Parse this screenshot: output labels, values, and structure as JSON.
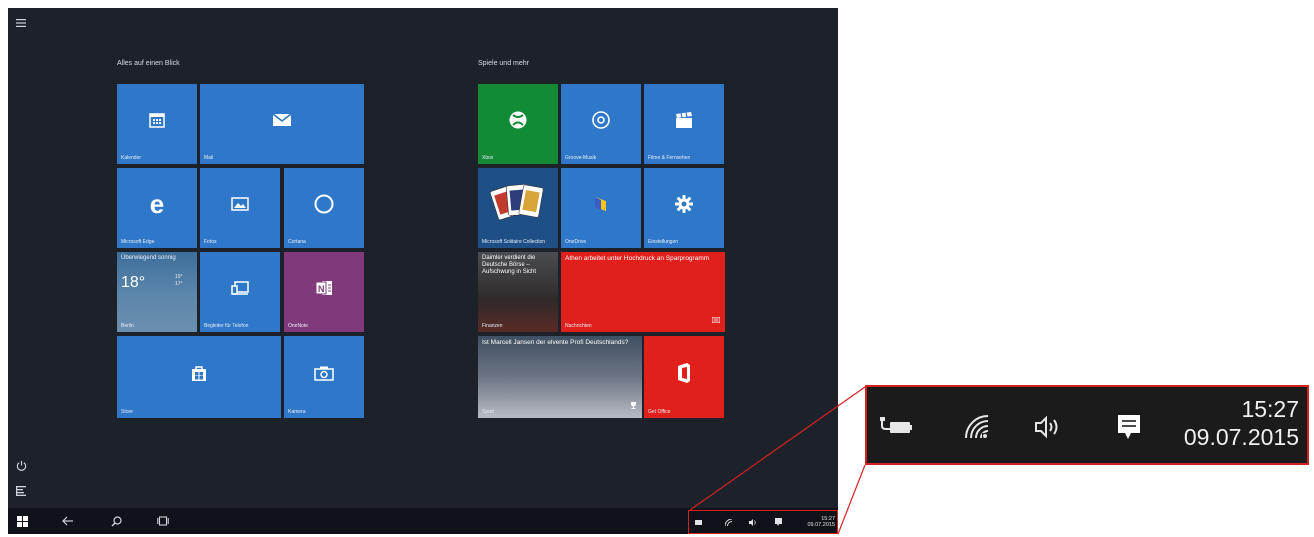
{
  "start": {
    "groups": [
      {
        "title": "Alles auf einen Blick"
      },
      {
        "title": "Spiele und mehr"
      }
    ],
    "tiles": {
      "kalender": {
        "label": "Kalender",
        "icon": "calendar-icon"
      },
      "mail": {
        "label": "Mail",
        "icon": "mail-icon"
      },
      "edge": {
        "label": "Microsoft Edge",
        "icon": "edge-icon"
      },
      "fotos": {
        "label": "Fotos",
        "icon": "photos-icon"
      },
      "cortana": {
        "label": "Cortana",
        "icon": "cortana-icon"
      },
      "weather": {
        "label": "Berlin",
        "condition": "Überwiegend sonnig",
        "temp": "18°",
        "hi": "19°",
        "lo": "17°"
      },
      "phone": {
        "label": "Begleiter für Telefon",
        "icon": "phone-companion-icon"
      },
      "onenote": {
        "label": "OneNote",
        "icon": "onenote-icon"
      },
      "store": {
        "label": "Store",
        "icon": "store-icon"
      },
      "camera": {
        "label": "Kamera",
        "icon": "camera-icon"
      },
      "xbox": {
        "label": "Xbox",
        "icon": "xbox-icon"
      },
      "groove": {
        "label": "Groove-Musik",
        "icon": "groove-icon"
      },
      "filme": {
        "label": "Filme & Fernsehen",
        "icon": "film-icon"
      },
      "solitaire": {
        "label": "Microsoft Solitaire Collection",
        "icon": "cards-icon"
      },
      "onedrive": {
        "label": "OneDrive",
        "icon": "onedrive-icon"
      },
      "settings": {
        "label": "Einstellungen",
        "icon": "gear-icon"
      },
      "finanzen": {
        "label": "Finanzen",
        "headline": "Daimler verdient die Deutsche Börse – Aufschwung in Sicht"
      },
      "nachrichten": {
        "label": "Nachrichten",
        "headline": "Athen arbeitet unter Hochdruck an Sparprogramm"
      },
      "sport": {
        "label": "Sport",
        "headline": "Ist Marcell Jansen der elvente Profi Deutschlands?"
      },
      "office": {
        "label": "Get Office",
        "icon": "office-icon"
      }
    }
  },
  "taskbar": {
    "time": "15:27",
    "date": "09.07.2015"
  },
  "zoom": {
    "time": "15:27",
    "date": "09.07.2015"
  },
  "colors": {
    "tile_blue": "#2f78c9",
    "xbox_green": "#138a36",
    "news_red": "#e1201c",
    "onenote_purple": "#80397b",
    "highlight": "#d62020"
  }
}
